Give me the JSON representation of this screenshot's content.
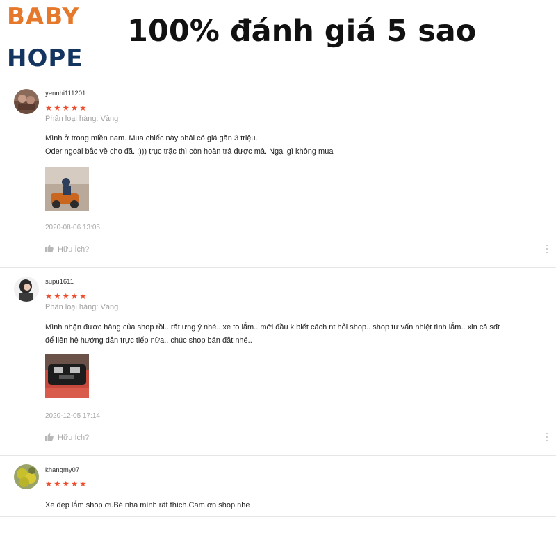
{
  "brand": {
    "line1": "BABY",
    "line2": "HOPE",
    "color1": "#e5782a",
    "color2": "#13355f"
  },
  "headline": "100% đánh giá 5 sao",
  "star_color": "#ee4d2d",
  "reviews": [
    {
      "username": "yennhi111201",
      "rating": 5,
      "stars": "★★★★★",
      "variation": "Phân loại hàng: Vàng",
      "comment_lines": [
        "Mình ở trong miền nam. Mua chiếc này phải có giá gần 3 triệu.",
        "Oder ngoài bắc về cho đã. :))) trục trặc thì còn hoàn trả được mà. Ngại gì không mua"
      ],
      "timestamp": "2020-08-06 13:05",
      "helpful_label": "Hữu Ích?"
    },
    {
      "username": "supu1611",
      "rating": 5,
      "stars": "★★★★★",
      "variation": "Phân loại hàng: Vàng",
      "comment_lines": [
        "Mình nhận được hàng của shop rồi.. rất ưng ý nhé.. xe to lắm.. mới đầu k biết cách nt hỏi shop.. shop tư vấn nhiệt tình lắm.. xin cả sđt",
        "để liên hệ hướng dẫn trực tiếp nữa.. chúc shop bán đắt nhé.."
      ],
      "timestamp": "2020-12-05 17:14",
      "helpful_label": "Hữu Ích?"
    },
    {
      "username": "khangmy07",
      "rating": 5,
      "stars": "★★★★★",
      "comment_lines": [
        "Xe đẹp lắm shop ơi.Bé nhà mình rất thích.Cam ơn shop nhe"
      ]
    }
  ]
}
